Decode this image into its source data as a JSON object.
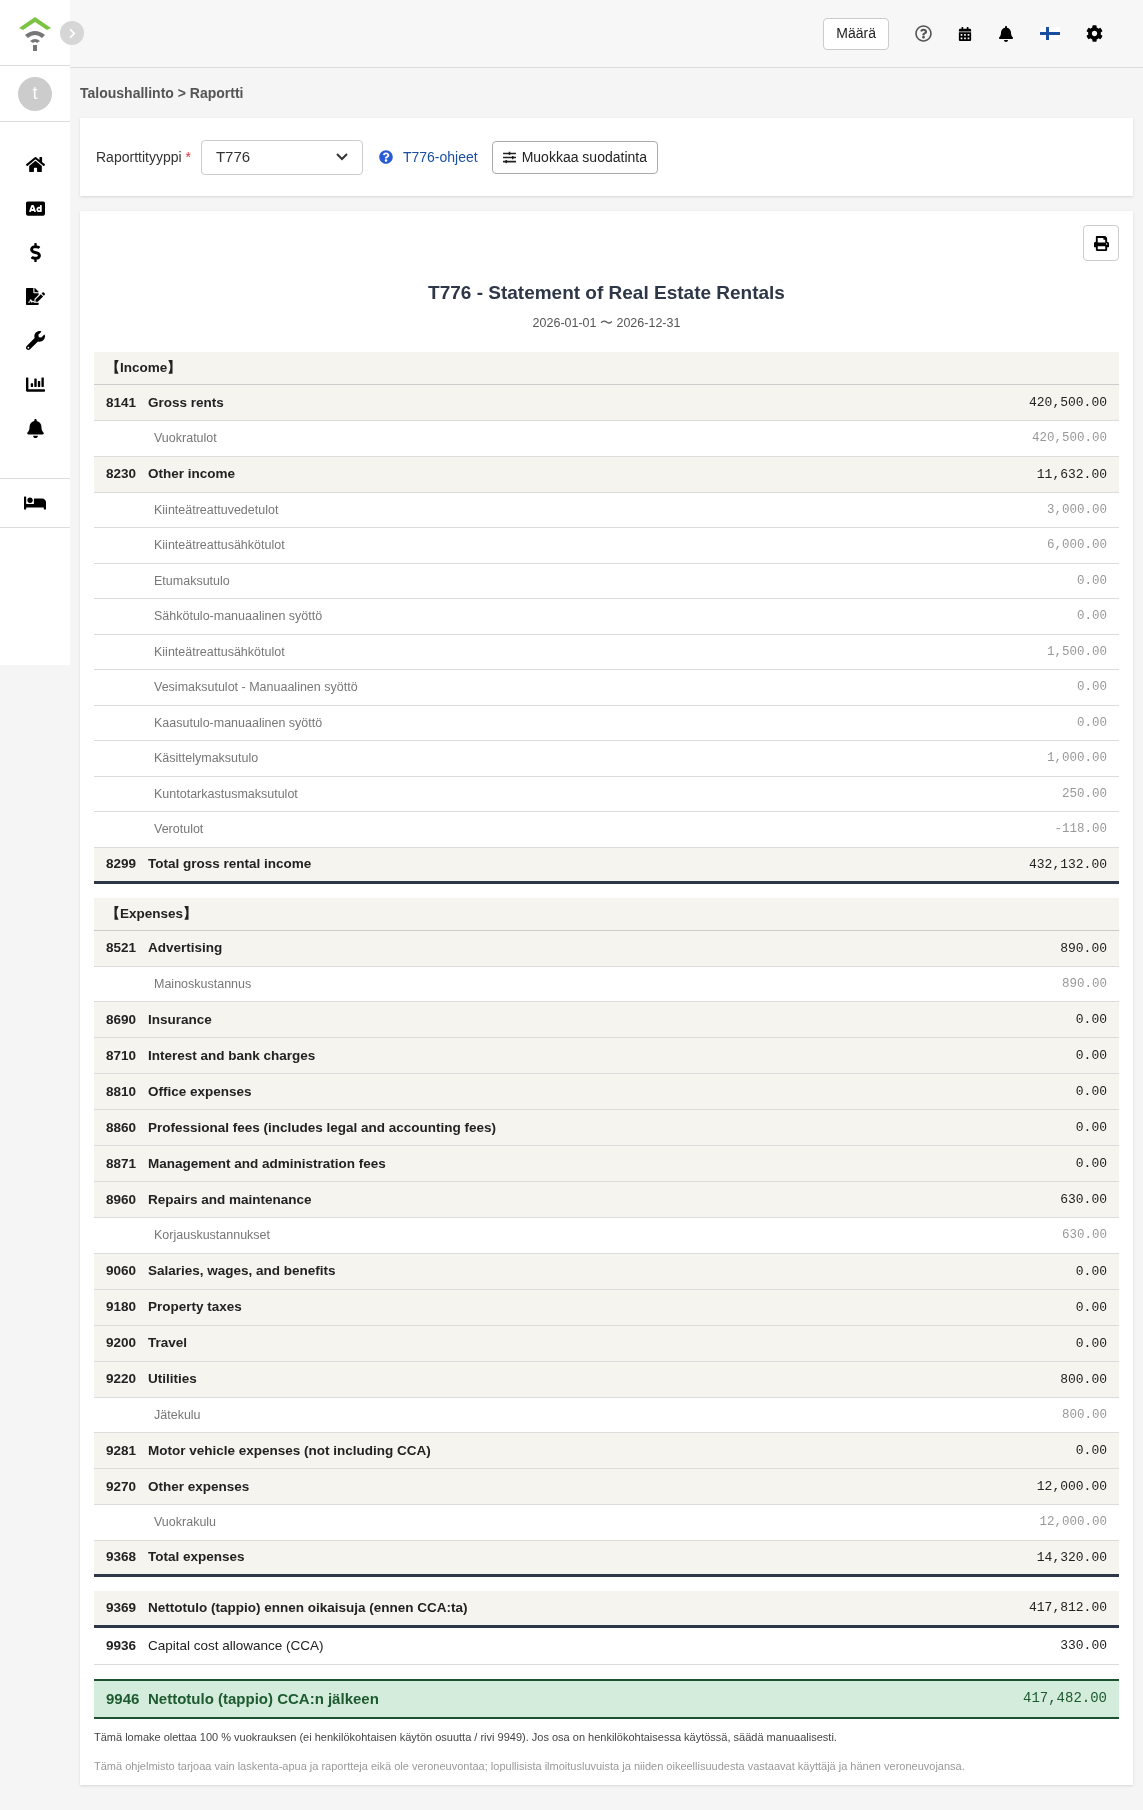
{
  "header": {
    "unit_button": "Määrä"
  },
  "sidebar": {
    "avatar": "t"
  },
  "breadcrumb": "Taloushallinto > Raportti",
  "filter": {
    "label": "Raporttityyppi",
    "required_mark": "*",
    "value": "T776",
    "help_link": "T776-ohjeet",
    "edit_button": "Muokkaa suodatinta"
  },
  "report": {
    "title": "T776 - Statement of Real Estate Rentals",
    "period": "2026-01-01 〜 2026-12-31",
    "sections": [
      {
        "heading": "【Income】",
        "rows": [
          {
            "kind": "account",
            "code": "8141",
            "label": "Gross rents",
            "amount": "420,500.00",
            "children": [
              {
                "label": "Vuokratulot",
                "amount": "420,500.00"
              }
            ]
          },
          {
            "kind": "account",
            "code": "8230",
            "label": "Other income",
            "amount": "11,632.00",
            "children": [
              {
                "label": "Kiinteätreattuvedetulot",
                "amount": "3,000.00"
              },
              {
                "label": "Kiinteätreattusähkötulot",
                "amount": "6,000.00"
              },
              {
                "label": "Etumaksutulo",
                "amount": "0.00"
              },
              {
                "label": "Sähkötulo-manuaalinen syöttö",
                "amount": "0.00"
              },
              {
                "label": "Kiinteätreattusähkötulot",
                "amount": "1,500.00"
              },
              {
                "label": "Vesimaksutulot - Manuaalinen syöttö",
                "amount": "0.00"
              },
              {
                "label": "Kaasutulo-manuaalinen syöttö",
                "amount": "0.00"
              },
              {
                "label": "Käsittelymaksutulo",
                "amount": "1,000.00"
              },
              {
                "label": "Kuntotarkastusmaksutulot",
                "amount": "250.00"
              },
              {
                "label": "Verotulot",
                "amount": "-118.00"
              }
            ]
          },
          {
            "kind": "total",
            "code": "8299",
            "label": "Total gross rental income",
            "amount": "432,132.00"
          }
        ]
      },
      {
        "heading": "【Expenses】",
        "rows": [
          {
            "kind": "account",
            "code": "8521",
            "label": "Advertising",
            "amount": "890.00",
            "children": [
              {
                "label": "Mainoskustannus",
                "amount": "890.00"
              }
            ]
          },
          {
            "kind": "account",
            "code": "8690",
            "label": "Insurance",
            "amount": "0.00"
          },
          {
            "kind": "account",
            "code": "8710",
            "label": "Interest and bank charges",
            "amount": "0.00"
          },
          {
            "kind": "account",
            "code": "8810",
            "label": "Office expenses",
            "amount": "0.00"
          },
          {
            "kind": "account",
            "code": "8860",
            "label": "Professional fees (includes legal and accounting fees)",
            "amount": "0.00"
          },
          {
            "kind": "account",
            "code": "8871",
            "label": "Management and administration fees",
            "amount": "0.00"
          },
          {
            "kind": "account",
            "code": "8960",
            "label": "Repairs and maintenance",
            "amount": "630.00",
            "children": [
              {
                "label": "Korjauskustannukset",
                "amount": "630.00"
              }
            ]
          },
          {
            "kind": "account",
            "code": "9060",
            "label": "Salaries, wages, and benefits",
            "amount": "0.00"
          },
          {
            "kind": "account",
            "code": "9180",
            "label": "Property taxes",
            "amount": "0.00"
          },
          {
            "kind": "account",
            "code": "9200",
            "label": "Travel",
            "amount": "0.00"
          },
          {
            "kind": "account",
            "code": "9220",
            "label": "Utilities",
            "amount": "800.00",
            "children": [
              {
                "label": "Jätekulu",
                "amount": "800.00"
              }
            ]
          },
          {
            "kind": "account",
            "code": "9281",
            "label": "Motor vehicle expenses (not including CCA)",
            "amount": "0.00"
          },
          {
            "kind": "account",
            "code": "9270",
            "label": "Other expenses",
            "amount": "12,000.00",
            "children": [
              {
                "label": "Vuokrakulu",
                "amount": "12,000.00"
              }
            ]
          },
          {
            "kind": "total",
            "code": "9368",
            "label": "Total expenses",
            "amount": "14,320.00"
          }
        ]
      }
    ],
    "summary": [
      {
        "kind": "net",
        "code": "9369",
        "label": "Nettotulo (tappio) ennen oikaisuja (ennen CCA:ta)",
        "amount": "417,812.00"
      },
      {
        "kind": "plain",
        "code": "9936",
        "label": "Capital cost allowance (CCA)",
        "amount": "330.00"
      },
      {
        "kind": "final",
        "code": "9946",
        "label": "Nettotulo (tappio) CCA:n jälkeen",
        "amount": "417,482.00"
      }
    ],
    "notes": [
      {
        "kind": "normal",
        "text": "Tämä lomake olettaa 100 % vuokrauksen (ei henkilökohtaisen käytön osuutta / rivi 9949). Jos osa on henkilökohtaisessa käytössä, säädä manuaalisesti."
      },
      {
        "kind": "muted",
        "text": "Tämä ohjelmisto tarjoaa vain laskenta-apua ja raportteja eikä ole veroneuvontaa; lopullisista ilmoitusluvuista ja niiden oikeellisuudesta vastaavat käyttäjä ja hänen veroneuvojansa."
      }
    ]
  }
}
